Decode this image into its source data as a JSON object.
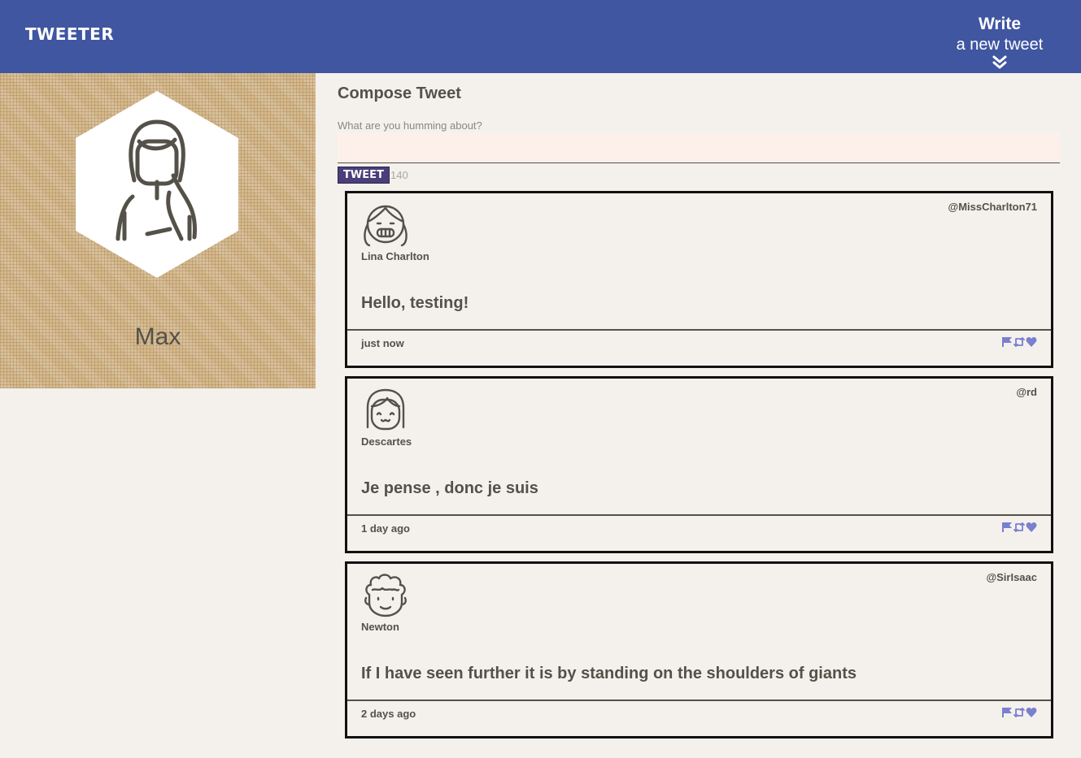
{
  "nav": {
    "brand": "TWEETER",
    "write_title": "Write",
    "write_subtitle": "a new tweet"
  },
  "profile": {
    "name": "Max"
  },
  "compose": {
    "title": "Compose Tweet",
    "label": "What are you humming about?",
    "value": "",
    "button_label": "TWEET",
    "counter": "140"
  },
  "colors": {
    "nav_bg": "#4056a1",
    "page_bg": "#f4f1ec",
    "text": "#545149",
    "action_icons": "#7b7fd0",
    "button_bg": "#4a3f7a"
  },
  "tweets": [
    {
      "avatar_icon": "girl-braids-avatar-icon",
      "name": "Lina Charlton",
      "handle": "@MissCharlton71",
      "content": "Hello, testing!",
      "time": "just now"
    },
    {
      "avatar_icon": "bob-hair-avatar-icon",
      "name": "Descartes",
      "handle": "@rd",
      "content": "Je pense , donc je suis",
      "time": "1 day ago"
    },
    {
      "avatar_icon": "curly-hair-avatar-icon",
      "name": "Newton",
      "handle": "@SirIsaac",
      "content": "If I have seen further it is by standing on the shoulders of giants",
      "time": "2 days ago"
    }
  ]
}
